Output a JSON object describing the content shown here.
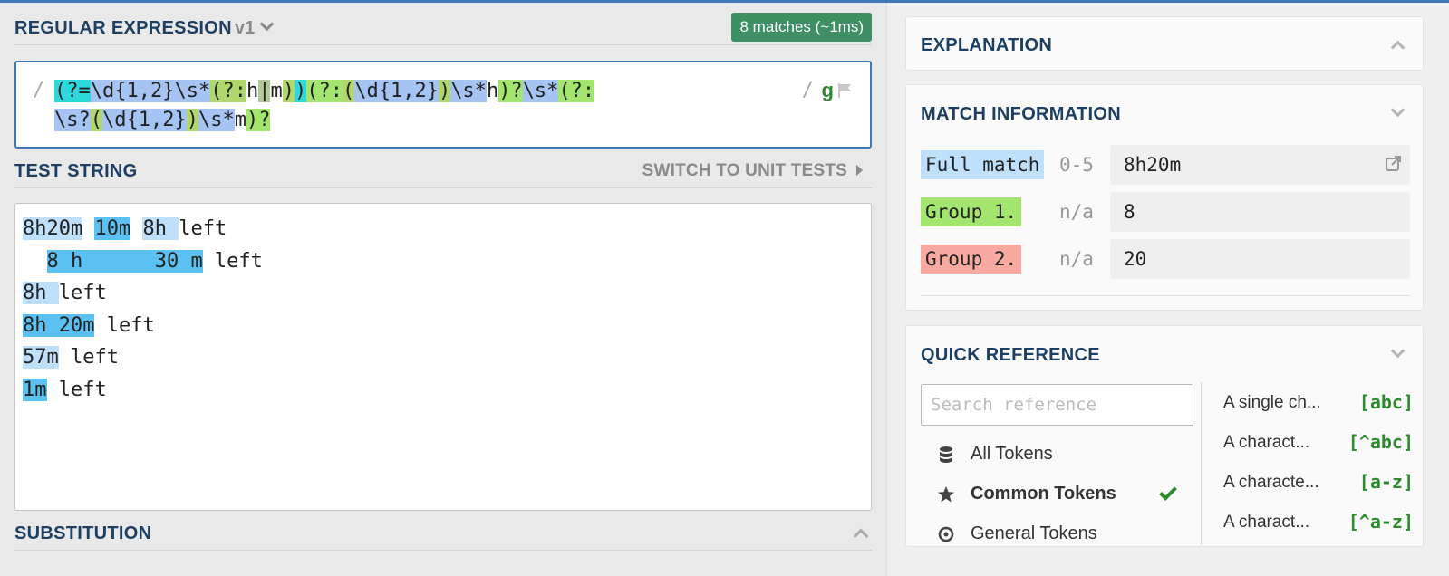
{
  "regex": {
    "section_title": "REGULAR EXPRESSION",
    "version": "v1",
    "match_badge": "8 matches (~1ms)",
    "open_delim": "/",
    "close_delim": "/",
    "flags": "g",
    "line1": [
      {
        "text": "(?=",
        "style": "look"
      },
      {
        "text": "\\d{1,2}",
        "style": "tok"
      },
      {
        "text": "\\s*",
        "style": "tok"
      },
      {
        "text": "(?:",
        "style": "ncg"
      },
      {
        "text": "h",
        "style": "none"
      },
      {
        "text": "|",
        "style": "ngrp"
      },
      {
        "text": "m",
        "style": "none"
      },
      {
        "text": ")",
        "style": "ncg"
      },
      {
        "text": ")",
        "style": "look"
      },
      {
        "text": "(?:",
        "style": "grp"
      },
      {
        "text": "(",
        "style": "ncg"
      },
      {
        "text": "\\d{1,2}",
        "style": "tok"
      },
      {
        "text": ")",
        "style": "ncg"
      },
      {
        "text": "\\s*",
        "style": "tok"
      },
      {
        "text": "h",
        "style": "none"
      },
      {
        "text": ")?",
        "style": "grp"
      },
      {
        "text": "\\s*",
        "style": "tok"
      },
      {
        "text": "(?:",
        "style": "grp"
      }
    ],
    "line2": [
      {
        "text": "\\s?",
        "style": "tok"
      },
      {
        "text": "(",
        "style": "ncg"
      },
      {
        "text": "\\d{1,2}",
        "style": "tok"
      },
      {
        "text": ")",
        "style": "ncg"
      },
      {
        "text": "\\s*",
        "style": "tok"
      },
      {
        "text": "m",
        "style": "none"
      },
      {
        "text": ")?",
        "style": "grp"
      }
    ]
  },
  "test": {
    "section_title": "TEST STRING",
    "switch_label": "SWITCH TO UNIT TESTS",
    "lines": [
      [
        {
          "text": "8h20m",
          "m": 1
        },
        {
          "text": " ",
          "m": 0
        },
        {
          "text": "10m",
          "m": 2
        },
        {
          "text": " ",
          "m": 0
        },
        {
          "text": "8h ",
          "m": 1
        },
        {
          "text": "left",
          "m": 0
        }
      ],
      [
        {
          "text": "  ",
          "m": 0
        },
        {
          "text": "8 h      30 m",
          "m": 2
        },
        {
          "text": " left",
          "m": 0
        }
      ],
      [
        {
          "text": "8h ",
          "m": 1
        },
        {
          "text": "left",
          "m": 0
        }
      ],
      [
        {
          "text": "8h 20m",
          "m": 2
        },
        {
          "text": " left",
          "m": 0
        }
      ],
      [
        {
          "text": "57m",
          "m": 1
        },
        {
          "text": " left",
          "m": 0
        }
      ],
      [
        {
          "text": "1m",
          "m": 2
        },
        {
          "text": " left",
          "m": 0
        }
      ]
    ]
  },
  "substitution": {
    "section_title": "SUBSTITUTION"
  },
  "explanation": {
    "title": "EXPLANATION"
  },
  "match_info": {
    "title": "MATCH INFORMATION",
    "rows": [
      {
        "label": "Full match",
        "range": "0-5",
        "value": "8h20m",
        "color": "#bfe0fb"
      },
      {
        "label": "Group 1.",
        "range": "n/a",
        "value": "8",
        "color": "#a4e56f"
      },
      {
        "label": "Group 2.",
        "range": "n/a",
        "value": "20",
        "color": "#f8a9a0"
      }
    ]
  },
  "quick_ref": {
    "title": "QUICK REFERENCE",
    "search_placeholder": "Search reference",
    "categories": [
      {
        "label": "All Tokens",
        "icon": "database-icon",
        "active": false
      },
      {
        "label": "Common Tokens",
        "icon": "star-icon",
        "active": true
      },
      {
        "label": "General Tokens",
        "icon": "target-icon",
        "active": false
      }
    ],
    "refs": [
      {
        "desc": "A single ch...",
        "token": "[abc]"
      },
      {
        "desc": "A charact...",
        "token": "[^abc]"
      },
      {
        "desc": "A characte...",
        "token": "[a-z]"
      },
      {
        "desc": "A charact...",
        "token": "[^a-z]"
      }
    ]
  }
}
